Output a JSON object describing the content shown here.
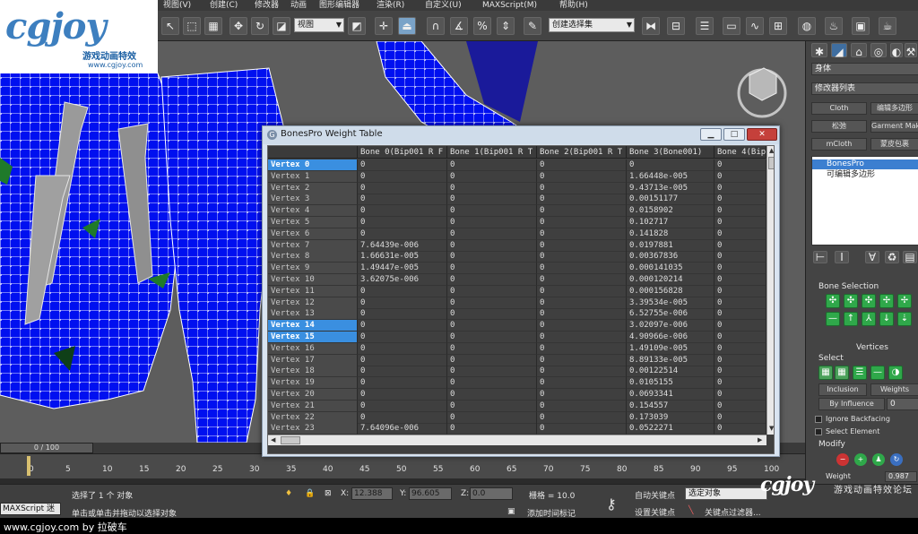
{
  "app": {
    "caption": "www.cgjoy.com by 拉破车"
  },
  "logo": {
    "brand": "cgjoy",
    "subtitle": "游戏动画特效",
    "url": "www.cgjoy.com"
  },
  "menu": [
    "视图(V)",
    "创建(C)",
    "修改器",
    "动画",
    "图形编辑器",
    "渲染(R)",
    "自定义(U)",
    "MAXScript(M)",
    "帮助(H)"
  ],
  "toolbar": {
    "view_dropdown": "视图",
    "selection_set": "创建选择集"
  },
  "command_panel": {
    "object_name": "身体",
    "modifier_list": "修改器列表",
    "quick_buttons": [
      {
        "left": "Cloth",
        "right": "编辑多边形"
      },
      {
        "left": "松弛",
        "right": "Garment Mak"
      },
      {
        "left": "mCloth",
        "right": "蒙皮包裹"
      }
    ],
    "stack": [
      "BonesPro",
      "可编辑多边形"
    ],
    "bone_selection_title": "Bone Selection",
    "vertices_title": "Vertices",
    "select_label": "Select",
    "inclusion": "Inclusion",
    "weights": "Weights",
    "by_influence": "By Influence",
    "by_influence_value": "0",
    "ignore_backfacing": "Ignore Backfacing",
    "select_element": "Select Element",
    "modify_label": "Modify",
    "weight_label": "Weight",
    "weight_value": "0.987"
  },
  "weight_table": {
    "title": "BonesPro Weight Table",
    "columns": [
      "Bone 0(Bip001 R F",
      "Bone 1(Bip001 R T",
      "Bone 2(Bip001 R T",
      "Bone 3(Bone001)",
      "Bone 4(Bip"
    ],
    "rows": [
      {
        "label": "Vertex 0",
        "selected": true,
        "values": [
          "0",
          "0",
          "0",
          "0",
          "0"
        ]
      },
      {
        "label": "Vertex 1",
        "selected": false,
        "values": [
          "0",
          "0",
          "0",
          "1.66448e-005",
          "0"
        ]
      },
      {
        "label": "Vertex 2",
        "selected": false,
        "values": [
          "0",
          "0",
          "0",
          "9.43713e-005",
          "0"
        ]
      },
      {
        "label": "Vertex 3",
        "selected": false,
        "values": [
          "0",
          "0",
          "0",
          "0.00151177",
          "0"
        ]
      },
      {
        "label": "Vertex 4",
        "selected": false,
        "values": [
          "0",
          "0",
          "0",
          "0.0158902",
          "0"
        ]
      },
      {
        "label": "Vertex 5",
        "selected": false,
        "values": [
          "0",
          "0",
          "0",
          "0.102717",
          "0"
        ]
      },
      {
        "label": "Vertex 6",
        "selected": false,
        "values": [
          "0",
          "0",
          "0",
          "0.141828",
          "0"
        ]
      },
      {
        "label": "Vertex 7",
        "selected": false,
        "values": [
          "7.64439e-006",
          "0",
          "0",
          "0.0197881",
          "0"
        ]
      },
      {
        "label": "Vertex 8",
        "selected": false,
        "values": [
          "1.66631e-005",
          "0",
          "0",
          "0.00367836",
          "0"
        ]
      },
      {
        "label": "Vertex 9",
        "selected": false,
        "values": [
          "1.49447e-005",
          "0",
          "0",
          "0.000141035",
          "0"
        ]
      },
      {
        "label": "Vertex 10",
        "selected": false,
        "values": [
          "3.62075e-006",
          "0",
          "0",
          "0.000120214",
          "0"
        ]
      },
      {
        "label": "Vertex 11",
        "selected": false,
        "values": [
          "0",
          "0",
          "0",
          "0.000156828",
          "0"
        ]
      },
      {
        "label": "Vertex 12",
        "selected": false,
        "values": [
          "0",
          "0",
          "0",
          "3.39534e-005",
          "0"
        ]
      },
      {
        "label": "Vertex 13",
        "selected": false,
        "values": [
          "0",
          "0",
          "0",
          "6.52755e-006",
          "0"
        ]
      },
      {
        "label": "Vertex 14",
        "selected": true,
        "values": [
          "0",
          "0",
          "0",
          "3.02097e-006",
          "0"
        ]
      },
      {
        "label": "Vertex 15",
        "selected": true,
        "values": [
          "0",
          "0",
          "0",
          "4.90966e-006",
          "0"
        ]
      },
      {
        "label": "Vertex 16",
        "selected": false,
        "values": [
          "0",
          "0",
          "0",
          "1.49109e-005",
          "0"
        ]
      },
      {
        "label": "Vertex 17",
        "selected": false,
        "values": [
          "0",
          "0",
          "0",
          "8.89133e-005",
          "0"
        ]
      },
      {
        "label": "Vertex 18",
        "selected": false,
        "values": [
          "0",
          "0",
          "0",
          "0.00122514",
          "0"
        ]
      },
      {
        "label": "Vertex 19",
        "selected": false,
        "values": [
          "0",
          "0",
          "0",
          "0.0105155",
          "0"
        ]
      },
      {
        "label": "Vertex 20",
        "selected": false,
        "values": [
          "0",
          "0",
          "0",
          "0.0693341",
          "0"
        ]
      },
      {
        "label": "Vertex 21",
        "selected": false,
        "values": [
          "0",
          "0",
          "0",
          "0.154557",
          "0"
        ]
      },
      {
        "label": "Vertex 22",
        "selected": false,
        "values": [
          "0",
          "0",
          "0",
          "0.173039",
          "0"
        ]
      },
      {
        "label": "Vertex 23",
        "selected": false,
        "values": [
          "7.64096e-006",
          "0",
          "0",
          "0.0522271",
          "0"
        ]
      }
    ]
  },
  "timeline": {
    "frame_display": "0 / 100",
    "ticks": [
      "0",
      "5",
      "10",
      "15",
      "20",
      "25",
      "30",
      "35",
      "40",
      "45",
      "50",
      "55",
      "60",
      "65",
      "70",
      "75",
      "80",
      "85",
      "90",
      "95",
      "100"
    ]
  },
  "status": {
    "maxscript_label": "MAXScript 迷",
    "selected_text": "选择了 1 个 对象",
    "prompt_text": "单击或单击并拖动以选择对象",
    "x_label": "X:",
    "x_value": "12.388",
    "y_label": "Y:",
    "y_value": "96.605",
    "z_label": "Z:",
    "z_value": "0.0",
    "grid_text": "栅格 = 10.0",
    "add_time_tag": "添加时间标记",
    "auto_key": "自动关键点",
    "set_key": "设置关键点",
    "selected_object": "选定对象",
    "key_filters": "关键点过滤器..."
  },
  "watermark": {
    "brand": "cgjoy",
    "tagline": "游戏动画特效论坛"
  }
}
